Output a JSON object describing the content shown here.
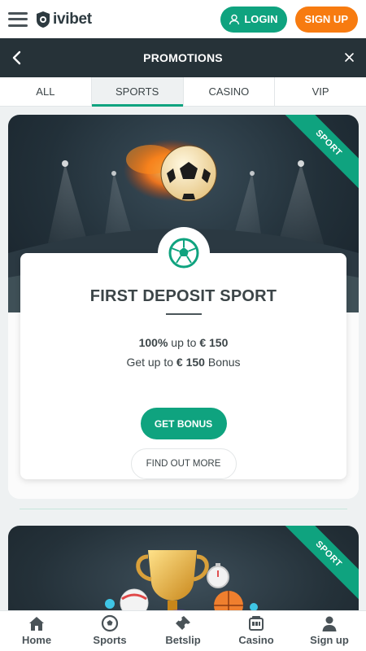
{
  "header": {
    "logo_text": "ivibet",
    "login_label": "LOGIN",
    "signup_label": "SIGN UP"
  },
  "titlebar": {
    "title": "PROMOTIONS"
  },
  "tabs": [
    {
      "label": "ALL",
      "active": false
    },
    {
      "label": "SPORTS",
      "active": true
    },
    {
      "label": "CASINO",
      "active": false
    },
    {
      "label": "VIP",
      "active": false
    }
  ],
  "promos": [
    {
      "ribbon": "SPORT",
      "title": "FIRST DEPOSIT SPORT",
      "line1_bold": "100%",
      "line1_rest": " up to ",
      "line1_amount": "€ 150",
      "line2_pre": "Get up to ",
      "line2_amount": "€ 150",
      "line2_post": " Bonus",
      "primary_button": "GET BONUS",
      "secondary_button": "FIND OUT MORE"
    },
    {
      "ribbon": "SPORT"
    }
  ],
  "bottom_nav": [
    {
      "label": "Home",
      "icon": "home-icon"
    },
    {
      "label": "Sports",
      "icon": "soccer-ball-icon"
    },
    {
      "label": "Betslip",
      "icon": "ticket-icon"
    },
    {
      "label": "Casino",
      "icon": "slot-machine-icon"
    },
    {
      "label": "Sign up",
      "icon": "user-icon"
    }
  ],
  "colors": {
    "accent": "#0fa37f",
    "signup": "#f77b10",
    "dark": "#263238"
  }
}
